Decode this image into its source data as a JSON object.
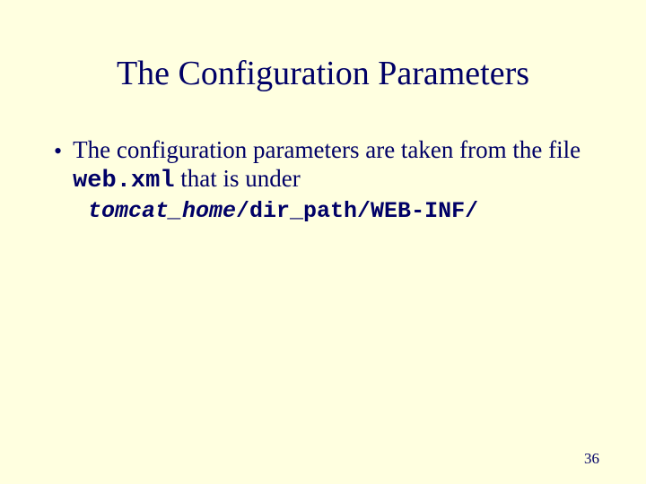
{
  "slide": {
    "title": "The Configuration Parameters",
    "bullet_text_part1": "The configuration parameters are taken from the file ",
    "bullet_code": "web.xml",
    "bullet_text_part2": " that is under",
    "path_italic": "tomcat_home",
    "path_rest": "/dir_path/WEB-INF/",
    "page_number": "36"
  }
}
